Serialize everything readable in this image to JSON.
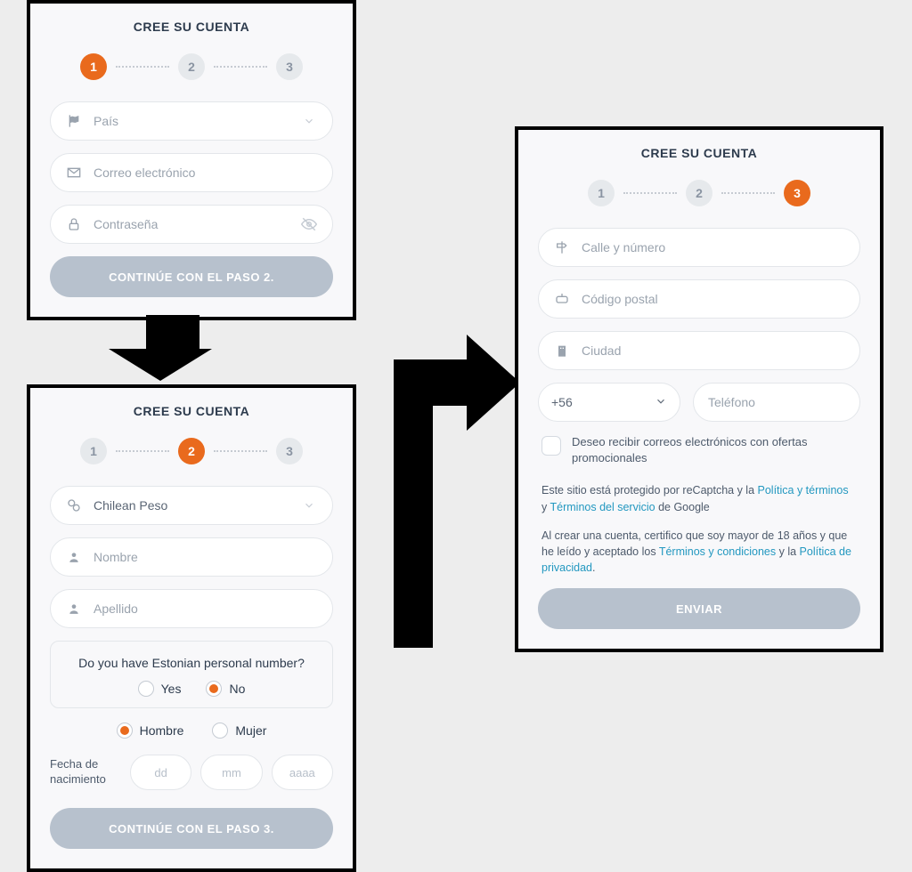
{
  "common": {
    "title": "CREE SU CUENTA"
  },
  "step1": {
    "active": 1,
    "pais": "País",
    "correo": "Correo electrónico",
    "contrasena": "Contraseña",
    "button": "CONTINÚE CON EL PASO 2."
  },
  "step2": {
    "active": 2,
    "currency": "Chilean Peso",
    "nombre": "Nombre",
    "apellido": "Apellido",
    "estQuestion": "Do you have Estonian personal number?",
    "yes": "Yes",
    "no": "No",
    "estSelected": "No",
    "genderM": "Hombre",
    "genderF": "Mujer",
    "genderSelected": "Hombre",
    "dobLabel": "Fecha de nacimiento",
    "dd": "dd",
    "mm": "mm",
    "yyyy": "aaaa",
    "button": "CONTINÚE CON EL PASO 3."
  },
  "step3": {
    "active": 3,
    "calle": "Calle y número",
    "postal": "Código postal",
    "ciudad": "Ciudad",
    "dialcode": "+56",
    "telefono": "Teléfono",
    "promo": "Deseo recibir correos electrónicos con ofertas promocionales",
    "recaptcha_pre": "Este sitio está protegido por reCaptcha y la ",
    "recaptcha_link1": "Política y términos",
    "recaptcha_mid": " y ",
    "recaptcha_link2": "Términos del servicio",
    "recaptcha_post": " de Google",
    "age_pre": "Al crear una cuenta, certifico que soy mayor de 18 años y que he leído y aceptado los ",
    "age_link1": "Términos y condiciones",
    "age_mid": " y la ",
    "age_link2": "Política de privacidad",
    "age_post": ".",
    "button": "ENVIAR"
  }
}
